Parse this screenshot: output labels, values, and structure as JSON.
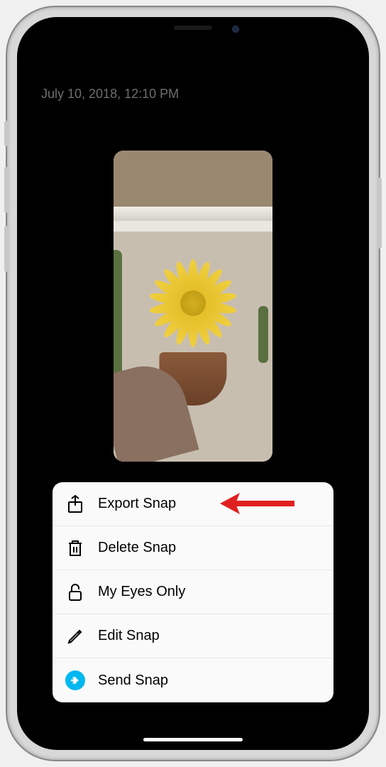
{
  "timestamp": "July 10, 2018, 12:10 PM",
  "menu": {
    "items": [
      {
        "icon": "share-icon",
        "label": "Export Snap"
      },
      {
        "icon": "trash-icon",
        "label": "Delete Snap"
      },
      {
        "icon": "lock-icon",
        "label": "My Eyes Only"
      },
      {
        "icon": "pencil-icon",
        "label": "Edit Snap"
      },
      {
        "icon": "send-icon",
        "label": "Send Snap"
      }
    ]
  },
  "annotation": {
    "type": "arrow",
    "color": "#e02020",
    "points_to": "Export Snap"
  }
}
